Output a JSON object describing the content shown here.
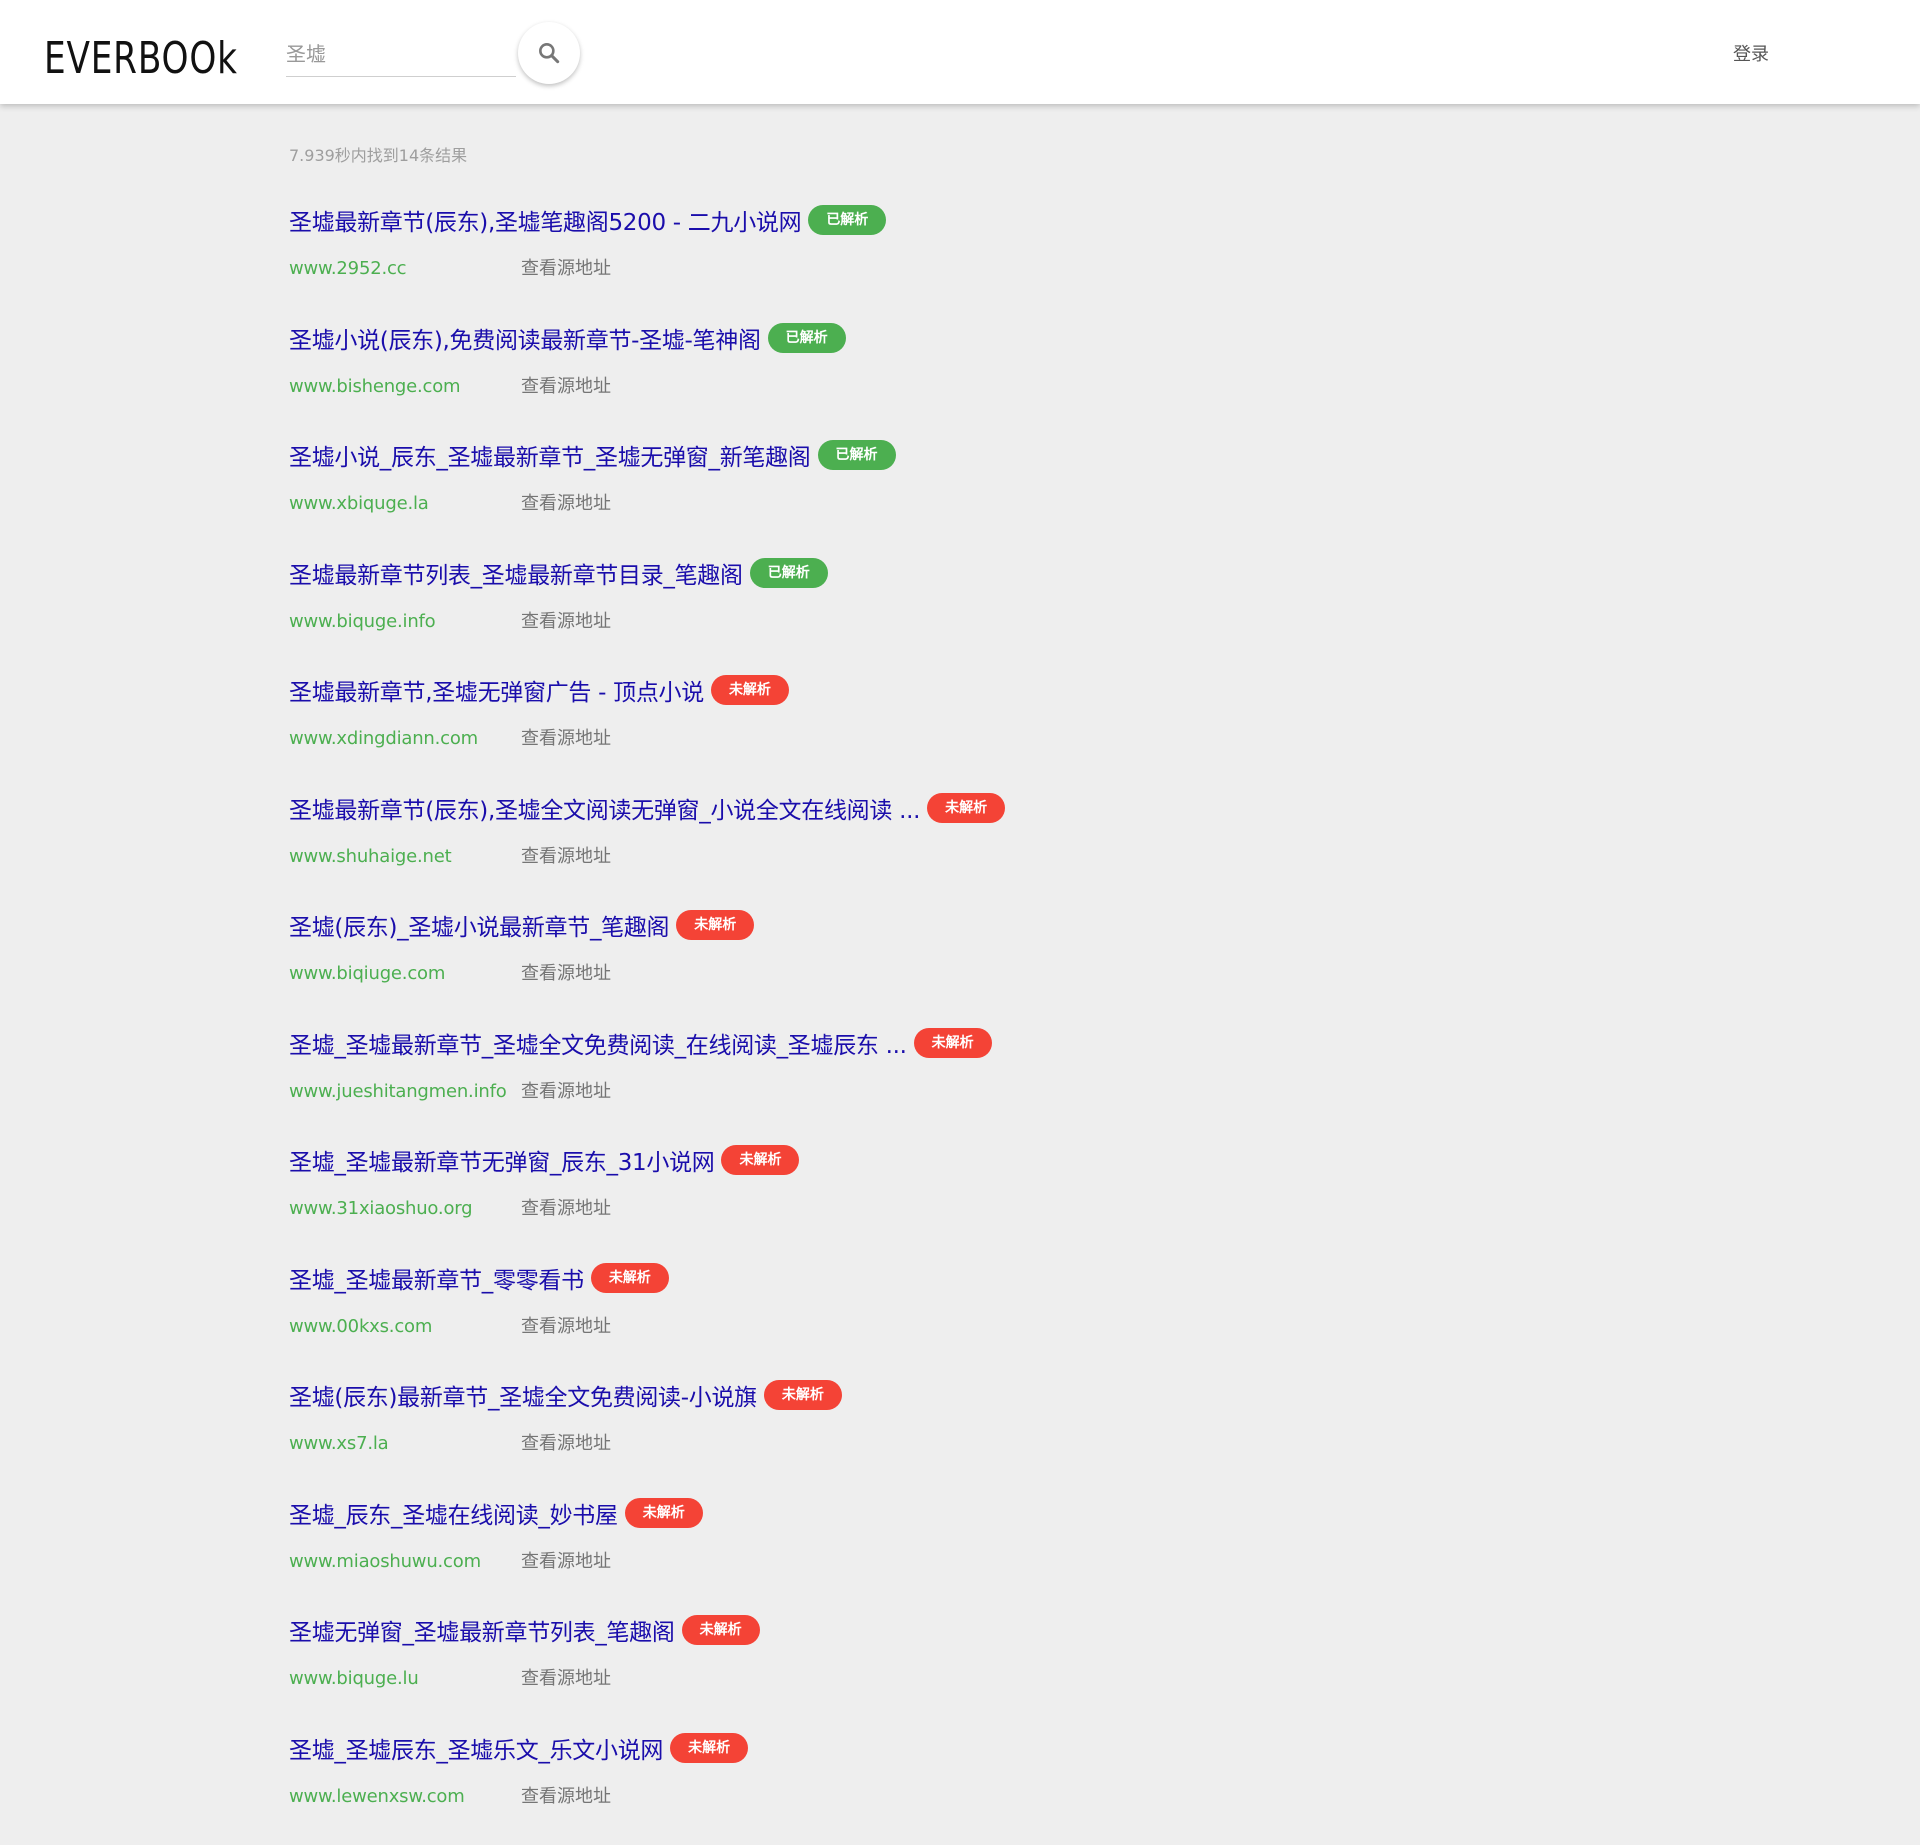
{
  "header": {
    "logo_text": "EVERBOOk",
    "search": {
      "value": "圣墟",
      "placeholder": ""
    },
    "login_label": "登录"
  },
  "stats_text": "7.939秒内找到14条结果",
  "results": [
    {
      "title": "圣墟最新章节(辰东),圣墟笔趣阁5200 - 二九小说网",
      "badge": "已解析",
      "status": "parsed",
      "domain": "www.2952.cc",
      "source_label": "查看源地址"
    },
    {
      "title": "圣墟小说(辰东),免费阅读最新章节-圣墟-笔神阁",
      "badge": "已解析",
      "status": "parsed",
      "domain": "www.bishenge.com",
      "source_label": "查看源地址"
    },
    {
      "title": "圣墟小说_辰东_圣墟最新章节_圣墟无弹窗_新笔趣阁",
      "badge": "已解析",
      "status": "parsed",
      "domain": "www.xbiquge.la",
      "source_label": "查看源地址"
    },
    {
      "title": "圣墟最新章节列表_圣墟最新章节目录_笔趣阁",
      "badge": "已解析",
      "status": "parsed",
      "domain": "www.biquge.info",
      "source_label": "查看源地址"
    },
    {
      "title": "圣墟最新章节,圣墟无弹窗广告 - 顶点小说",
      "badge": "未解析",
      "status": "unparsed",
      "domain": "www.xdingdiann.com",
      "source_label": "查看源地址"
    },
    {
      "title": "圣墟最新章节(辰东),圣墟全文阅读无弹窗_小说全文在线阅读 ...",
      "badge": "未解析",
      "status": "unparsed",
      "domain": "www.shuhaige.net",
      "source_label": "查看源地址"
    },
    {
      "title": "圣墟(辰东)_圣墟小说最新章节_笔趣阁",
      "badge": "未解析",
      "status": "unparsed",
      "domain": "www.biqiuge.com",
      "source_label": "查看源地址"
    },
    {
      "title": "圣墟_圣墟最新章节_圣墟全文免费阅读_在线阅读_圣墟辰东 ...",
      "badge": "未解析",
      "status": "unparsed",
      "domain": "www.jueshitangmen.info",
      "source_label": "查看源地址"
    },
    {
      "title": "圣墟_圣墟最新章节无弹窗_辰东_31小说网",
      "badge": "未解析",
      "status": "unparsed",
      "domain": "www.31xiaoshuo.org",
      "source_label": "查看源地址"
    },
    {
      "title": "圣墟_圣墟最新章节_零零看书",
      "badge": "未解析",
      "status": "unparsed",
      "domain": "www.00kxs.com",
      "source_label": "查看源地址"
    },
    {
      "title": "圣墟(辰东)最新章节_圣墟全文免费阅读-小说旗",
      "badge": "未解析",
      "status": "unparsed",
      "domain": "www.xs7.la",
      "source_label": "查看源地址"
    },
    {
      "title": "圣墟_辰东_圣墟在线阅读_妙书屋",
      "badge": "未解析",
      "status": "unparsed",
      "domain": "www.miaoshuwu.com",
      "source_label": "查看源地址"
    },
    {
      "title": "圣墟无弹窗_圣墟最新章节列表_笔趣阁",
      "badge": "未解析",
      "status": "unparsed",
      "domain": "www.biquge.lu",
      "source_label": "查看源地址"
    },
    {
      "title": "圣墟_圣墟辰东_圣墟乐文_乐文小说网",
      "badge": "未解析",
      "status": "unparsed",
      "domain": "www.lewenxsw.com",
      "source_label": "查看源地址"
    }
  ],
  "colors": {
    "title_link": "#1a0dab",
    "domain": "#4caf50",
    "badge_parsed": "#4caf50",
    "badge_unparsed": "#f44336",
    "page_bg": "#eeeeee"
  },
  "icons": {
    "search_button": "search-icon"
  }
}
